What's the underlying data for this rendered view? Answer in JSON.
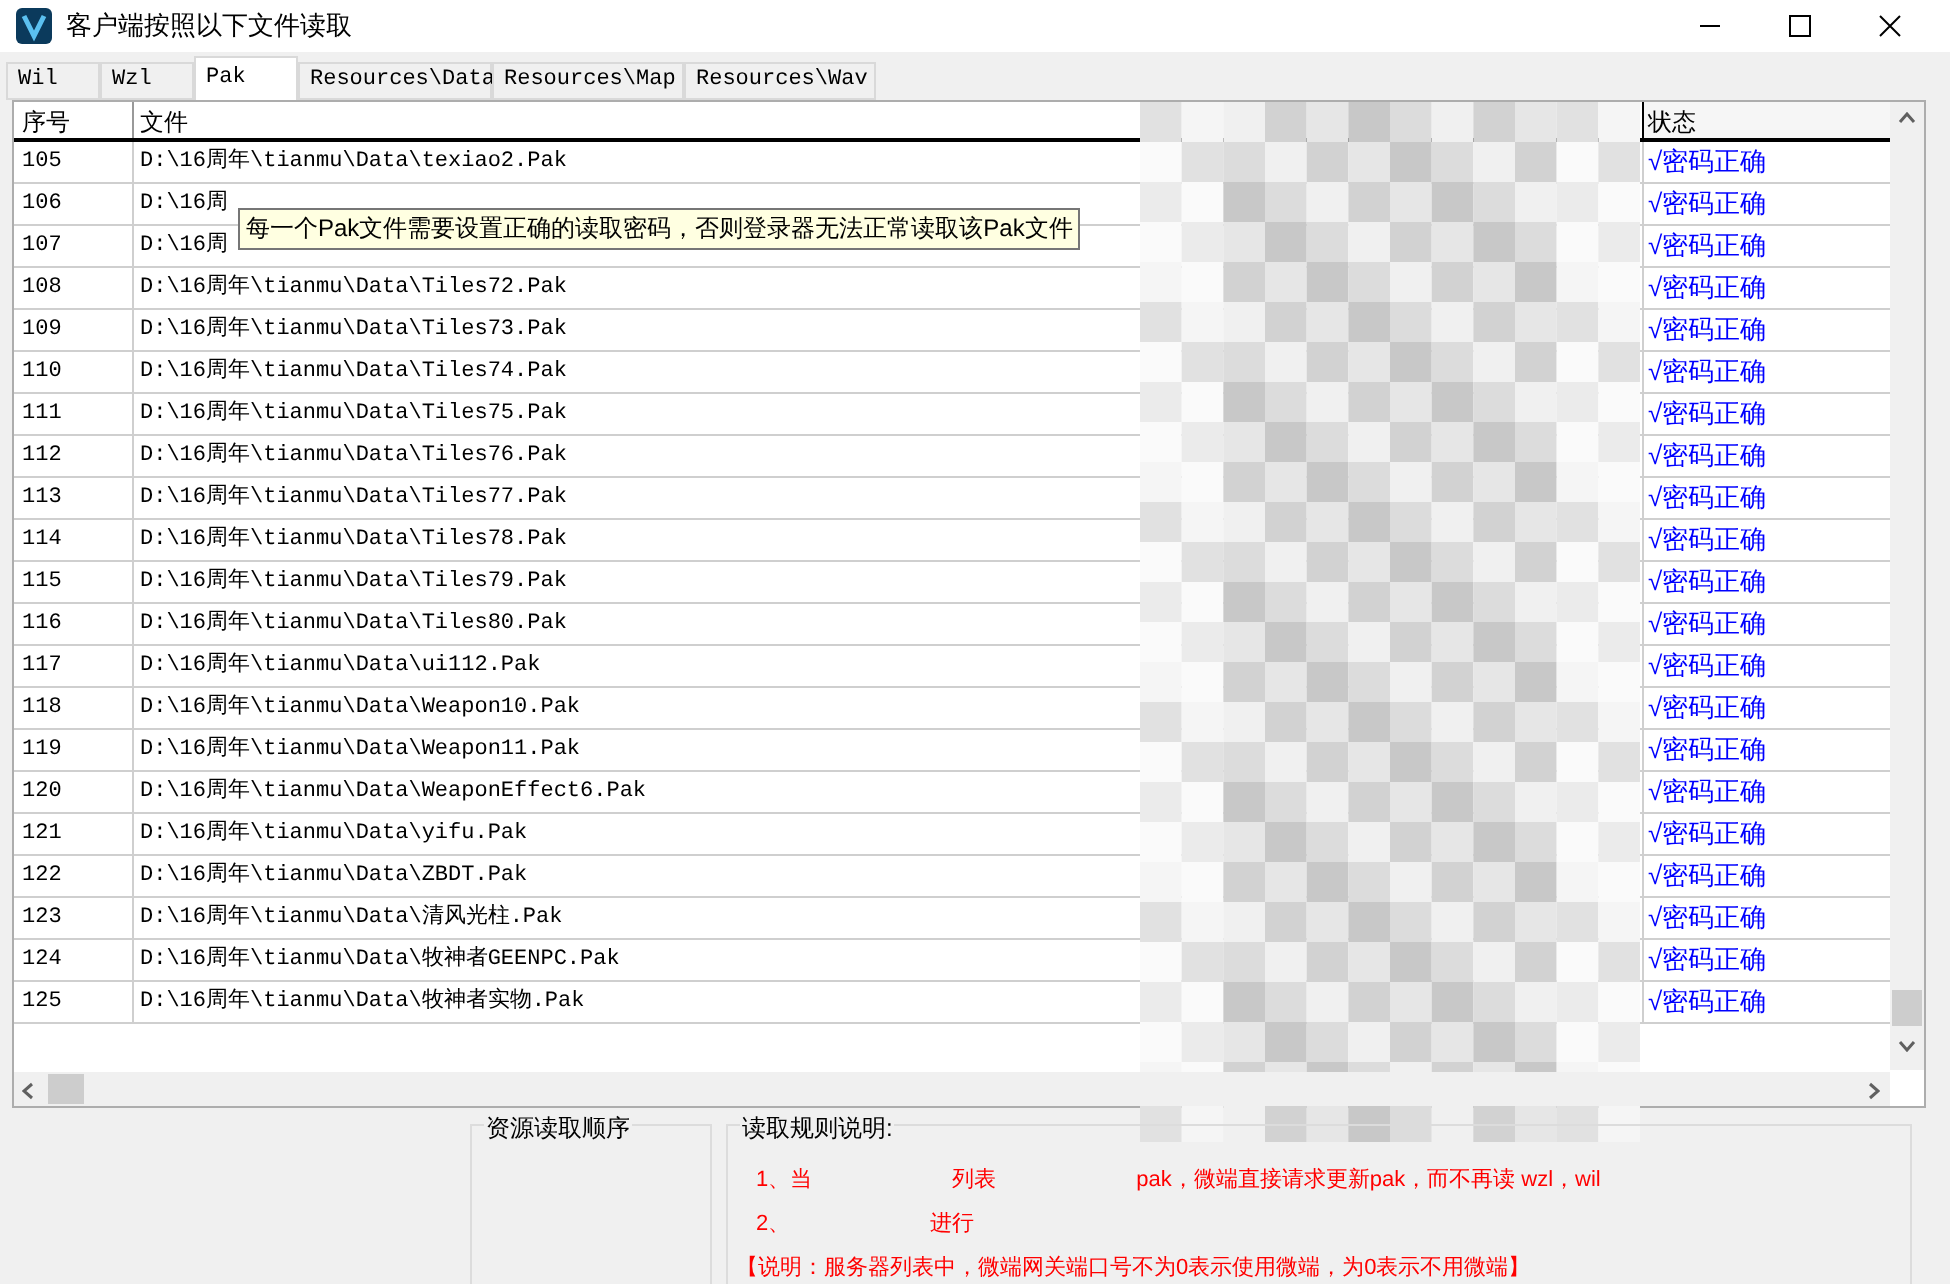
{
  "window": {
    "title": "客户端按照以下文件读取"
  },
  "tabs": [
    {
      "label": "Wil",
      "selected": false
    },
    {
      "label": "Wzl",
      "selected": false
    },
    {
      "label": "Pak",
      "selected": true
    },
    {
      "label": "Resources\\Data",
      "selected": false
    },
    {
      "label": "Resources\\Map",
      "selected": false
    },
    {
      "label": "Resources\\Wav",
      "selected": false
    }
  ],
  "table": {
    "columns": [
      "序号",
      "文件",
      "状态"
    ],
    "rows": [
      {
        "index": "105",
        "file": "D:\\16周年\\tianmu\\Data\\texiao2.Pak",
        "status": "√密码正确"
      },
      {
        "index": "106",
        "file": "D:\\16周",
        "status": "√密码正确"
      },
      {
        "index": "107",
        "file": "D:\\16周",
        "status": "√密码正确"
      },
      {
        "index": "108",
        "file": "D:\\16周年\\tianmu\\Data\\Tiles72.Pak",
        "status": "√密码正确"
      },
      {
        "index": "109",
        "file": "D:\\16周年\\tianmu\\Data\\Tiles73.Pak",
        "status": "√密码正确"
      },
      {
        "index": "110",
        "file": "D:\\16周年\\tianmu\\Data\\Tiles74.Pak",
        "status": "√密码正确"
      },
      {
        "index": "111",
        "file": "D:\\16周年\\tianmu\\Data\\Tiles75.Pak",
        "status": "√密码正确"
      },
      {
        "index": "112",
        "file": "D:\\16周年\\tianmu\\Data\\Tiles76.Pak",
        "status": "√密码正确"
      },
      {
        "index": "113",
        "file": "D:\\16周年\\tianmu\\Data\\Tiles77.Pak",
        "status": "√密码正确"
      },
      {
        "index": "114",
        "file": "D:\\16周年\\tianmu\\Data\\Tiles78.Pak",
        "status": "√密码正确"
      },
      {
        "index": "115",
        "file": "D:\\16周年\\tianmu\\Data\\Tiles79.Pak",
        "status": "√密码正确"
      },
      {
        "index": "116",
        "file": "D:\\16周年\\tianmu\\Data\\Tiles80.Pak",
        "status": "√密码正确"
      },
      {
        "index": "117",
        "file": "D:\\16周年\\tianmu\\Data\\ui112.Pak",
        "status": "√密码正确"
      },
      {
        "index": "118",
        "file": "D:\\16周年\\tianmu\\Data\\Weapon10.Pak",
        "status": "√密码正确"
      },
      {
        "index": "119",
        "file": "D:\\16周年\\tianmu\\Data\\Weapon11.Pak",
        "status": "√密码正确"
      },
      {
        "index": "120",
        "file": "D:\\16周年\\tianmu\\Data\\WeaponEffect6.Pak",
        "status": "√密码正确"
      },
      {
        "index": "121",
        "file": "D:\\16周年\\tianmu\\Data\\yifu.Pak",
        "status": "√密码正确"
      },
      {
        "index": "122",
        "file": "D:\\16周年\\tianmu\\Data\\ZBDT.Pak",
        "status": "√密码正确"
      },
      {
        "index": "123",
        "file": "D:\\16周年\\tianmu\\Data\\清风光柱.Pak",
        "status": "√密码正确"
      },
      {
        "index": "124",
        "file": "D:\\16周年\\tianmu\\Data\\牧神者GEENPC.Pak",
        "status": "√密码正确"
      },
      {
        "index": "125",
        "file": "D:\\16周年\\tianmu\\Data\\牧神者实物.Pak",
        "status": "√密码正确"
      }
    ]
  },
  "tooltip": "每一个Pak文件需要设置正确的读取密码，否则登录器无法正常读取该Pak文件",
  "order_group": {
    "title": "资源读取顺序"
  },
  "rules_group": {
    "title": "读取规则说明:",
    "lines": [
      {
        "parts": [
          "1、当",
          "列表",
          "pak，微端直接请求更新pak，而不再读 wzl，wil"
        ]
      },
      {
        "parts": [
          "2、",
          "进行"
        ]
      },
      {
        "parts": [
          "【说明：服务器列表中，微端网关端口号不为0表示使用微端，为0表示不用微端】"
        ]
      }
    ]
  }
}
